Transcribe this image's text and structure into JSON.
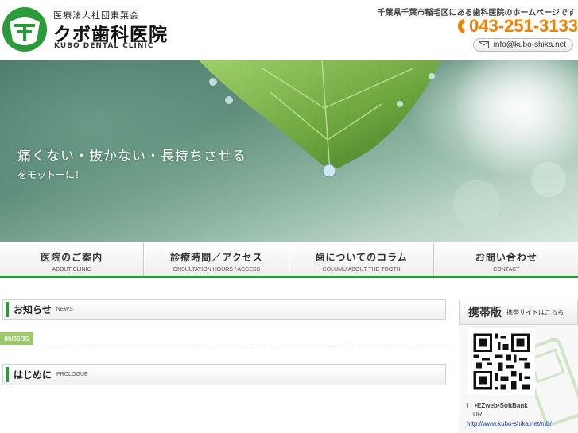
{
  "header": {
    "corp_name": "医療法人社団東菜会",
    "clinic_name": "クボ歯科医院",
    "clinic_name_en": "KUBO DENTAL CLINIC",
    "tagline": "千葉県千葉市稲毛区にある歯科医院のホームページです",
    "phone": "043-251-3133",
    "email": "info@kubo-shika.net",
    "phone_color": "#f08200",
    "brand_green": "#2a9a3a"
  },
  "hero": {
    "title": "痛くない・抜かない・長持ちさせる",
    "subtitle": "をモットーに！"
  },
  "nav": {
    "items": [
      {
        "jp": "医院のご案内",
        "en": "ABOUT CLINIC"
      },
      {
        "jp": "診療時間／アクセス",
        "en": "ONSULTATION HOURS / ACCESS"
      },
      {
        "jp": "歯についてのコラム",
        "en": "COLUMU ABOUT THE TOOTH"
      },
      {
        "jp": "お問い合わせ",
        "en": "CONTACT"
      }
    ]
  },
  "main": {
    "news": {
      "title": "お知らせ",
      "title_en": "NEWS",
      "date": "09/05/15"
    },
    "prologue": {
      "title": "はじめに",
      "title_en": "PROLOGUE"
    }
  },
  "sidebar": {
    "title": "携帯版",
    "subtitle": "携帯サイトはこちら",
    "carriers": "i　•EZweb•SoftBank",
    "url_label": "URL",
    "url": "http://www.kubo-shika.net/mb/"
  }
}
